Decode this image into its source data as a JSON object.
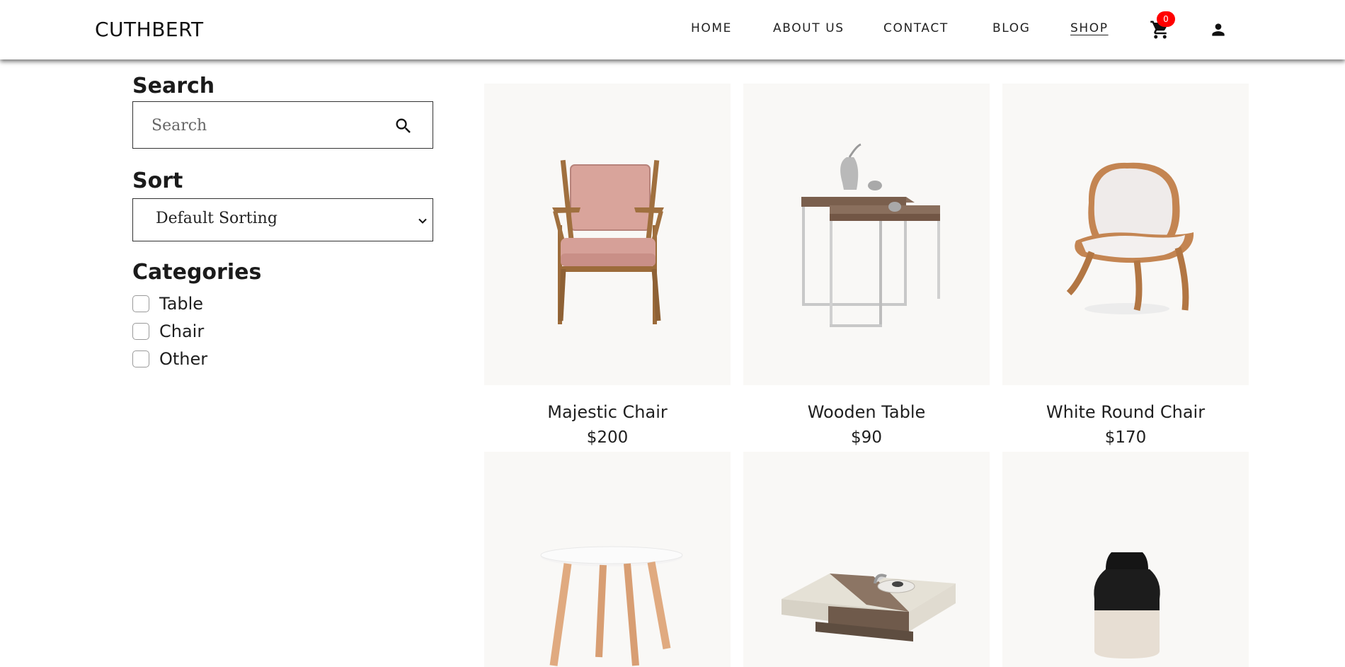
{
  "nav": {
    "brand": "CUTHBERT",
    "links": [
      "HOME",
      "ABOUT US",
      "CONTACT",
      "BLOG",
      "SHOP"
    ],
    "active": "SHOP",
    "cart_count": "0",
    "cart_icon": "shopping-cart-icon",
    "user_icon": "user-icon"
  },
  "sidebar": {
    "search_heading": "Search",
    "search_placeholder": "Search",
    "sort_heading": "Sort",
    "sort_value": "Default Sorting",
    "categories_heading": "Categories",
    "categories": [
      "Table",
      "Chair",
      "Other"
    ]
  },
  "products": [
    {
      "name": "Majestic Chair",
      "price": "$200"
    },
    {
      "name": "Wooden Table",
      "price": "$90"
    },
    {
      "name": "White Round Chair",
      "price": "$170"
    },
    {
      "name": "",
      "price": ""
    },
    {
      "name": "",
      "price": ""
    },
    {
      "name": "",
      "price": ""
    }
  ],
  "colors": {
    "badge": "#ff0000",
    "card_bg": "#f9f8f6"
  }
}
